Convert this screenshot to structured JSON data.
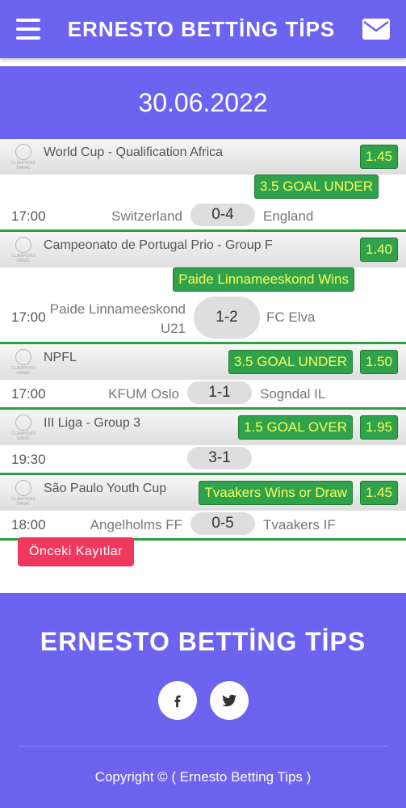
{
  "header": {
    "title": "ERNESTO BETTİNG TİPS"
  },
  "date": "30.06.2022",
  "logo_text": "CLAMPIONS SANAC",
  "matches": [
    {
      "league": "World Cup - Qualification Africa",
      "odds": "1.45",
      "tip": "3.5 GOAL UNDER",
      "time": "17:00",
      "home": "Switzerland",
      "score": "0-4",
      "away": "England"
    },
    {
      "league": "Campeonato de Portugal Prio - Group F",
      "odds": "1.40",
      "tip": "Paide Linnameeskond Wins",
      "time": "17:00",
      "home": "Paide Linnameeskond U21",
      "score": "1-2",
      "away": "FC Elva"
    },
    {
      "league": "NPFL",
      "odds": "1.50",
      "tip": "3.5 GOAL UNDER",
      "time": "17:00",
      "home": "KFUM Oslo",
      "score": "1-1",
      "away": "Sogndal IL"
    },
    {
      "league": "III Liga - Group 3",
      "odds": "1.95",
      "tip": "1.5 GOAL OVER",
      "time": "19:30",
      "home": "",
      "score": "3-1",
      "away": ""
    },
    {
      "league": "São Paulo Youth Cup",
      "odds": "1.45",
      "tip": "Tvaakers Wins or Draw",
      "time": "18:00",
      "home": "Angelholms FF",
      "score": "0-5",
      "away": "Tvaakers IF"
    }
  ],
  "prev_button": "Önceki Kayıtlar",
  "footer": {
    "title": "ERNESTO BETTİNG TİPS",
    "copyright": "Copyright © ( Ernesto Betting Tips )"
  },
  "icons": {
    "menu": "hamburger-icon",
    "mail": "envelope-icon",
    "facebook": "facebook-icon",
    "twitter": "twitter-icon"
  },
  "colors": {
    "primary": "#6c63f0",
    "tip_bg": "#31a24c",
    "tip_text": "#f8ff5e",
    "button": "#f0385e"
  }
}
